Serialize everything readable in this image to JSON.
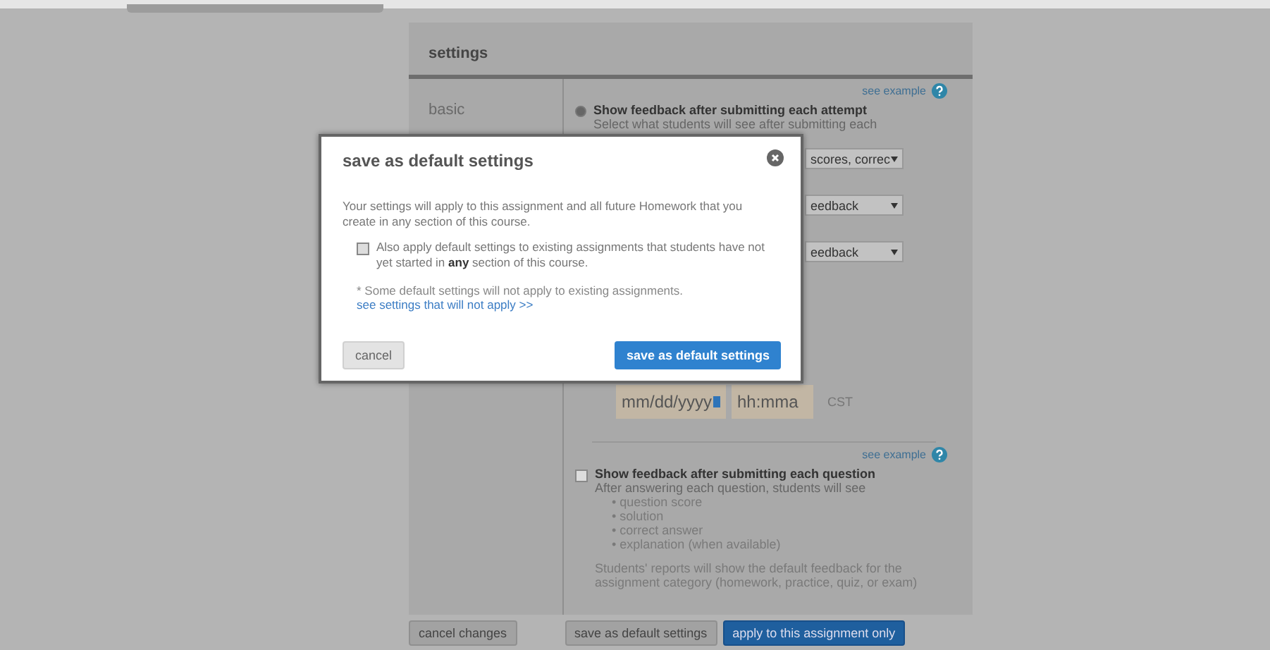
{
  "panel": {
    "title": "settings",
    "section": "basic",
    "attempt_option": {
      "link": "see example",
      "selected": true,
      "label": "Show feedback after submitting each attempt",
      "hint": "Select what students will see after submitting each",
      "dropdowns": [
        "scores, correc",
        "eedback",
        "eedback"
      ]
    },
    "due": {
      "date_placeholder": "mm/dd/yyyy",
      "time_placeholder": "hh:mma",
      "timezone": "CST"
    },
    "question_option": {
      "link": "see example",
      "checked": false,
      "label": "Show feedback after submitting each question",
      "intro": "After answering each question, students will see",
      "bullets": [
        "• question score",
        "• solution",
        "• correct answer",
        "• explanation (when available)"
      ],
      "note": "Students' reports will show the default feedback for the assignment category (homework, practice, quiz, or exam)"
    }
  },
  "footer_buttons": [
    {
      "label": "cancel changes",
      "kind": "plain"
    },
    {
      "label": "save as default settings",
      "kind": "plain"
    },
    {
      "label": "apply to this assignment only",
      "kind": "primary"
    }
  ],
  "dialog": {
    "title": "save as default settings",
    "message": "Your settings will apply to this assignment and all future Homework that you create in any section of this course.",
    "option": {
      "label": "Also apply default settings to existing assignments that students have not yet started in **any** section of this course.",
      "checked": false
    },
    "note": "* Some default settings will not apply to existing assignments.",
    "link": "see settings that will not apply >>",
    "buttons": [
      {
        "label": "cancel",
        "kind": "plain"
      },
      {
        "label": "save as default settings",
        "kind": "primary"
      }
    ]
  }
}
